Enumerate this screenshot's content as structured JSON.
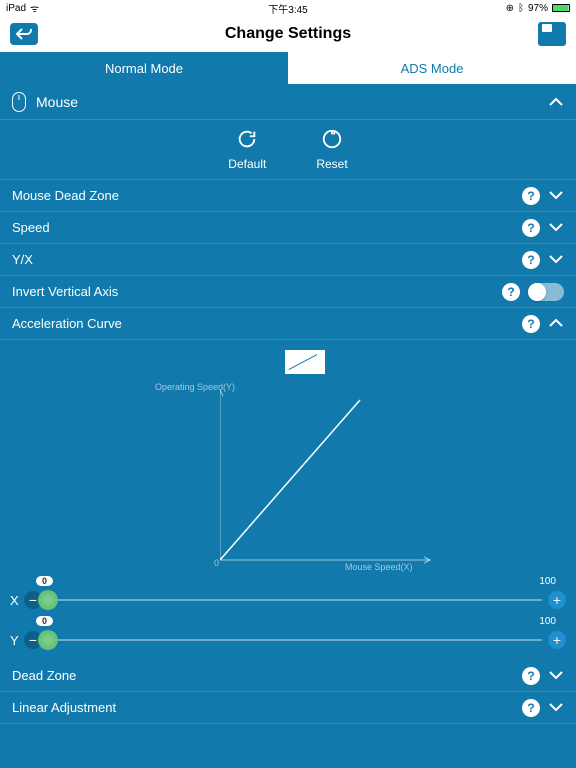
{
  "status": {
    "device": "iPad",
    "time": "下午3:45",
    "battery": "97%"
  },
  "header": {
    "title": "Change Settings"
  },
  "tabs": {
    "normal": "Normal Mode",
    "ads": "ADS Mode",
    "active": "normal"
  },
  "section": {
    "mouse": "Mouse"
  },
  "actions": {
    "default": "Default",
    "reset": "Reset"
  },
  "settings": {
    "deadzone": "Mouse Dead Zone",
    "speed": "Speed",
    "yx": "Y/X",
    "invert": "Invert Vertical Axis",
    "accel": "Acceleration Curve",
    "deadzone2": "Dead Zone",
    "linear": "Linear Adjustment"
  },
  "chart": {
    "ylabel": "Operating Speed(Y)",
    "xlabel": "Mouse Speed(X)",
    "zero": "0"
  },
  "sliders": {
    "x": {
      "label": "X",
      "value": "0",
      "max": "100"
    },
    "y": {
      "label": "Y",
      "value": "0",
      "max": "100"
    }
  },
  "chart_data": {
    "type": "line",
    "title": "Acceleration Curve",
    "xlabel": "Mouse Speed(X)",
    "ylabel": "Operating Speed(Y)",
    "x": [
      0,
      100
    ],
    "values": [
      0,
      100
    ],
    "xlim": [
      0,
      100
    ],
    "ylim": [
      0,
      100
    ]
  }
}
